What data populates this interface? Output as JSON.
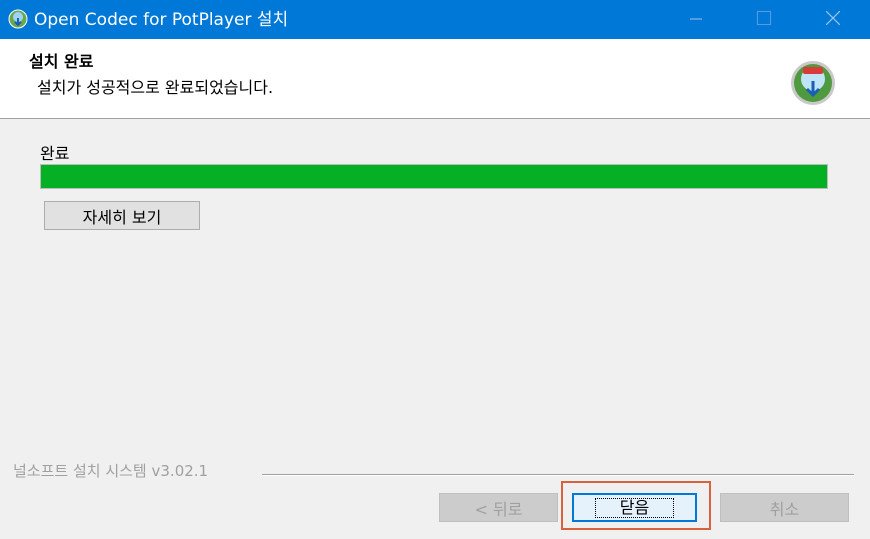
{
  "window": {
    "title": "Open Codec for PotPlayer 설치",
    "controls": {
      "minimize": "minimize-icon",
      "maximize": "maximize-icon",
      "close": "close-icon"
    }
  },
  "header": {
    "title": "설치 완료",
    "subtitle": "설치가 성공적으로 완료되었습니다."
  },
  "main": {
    "status_label": "완료",
    "progress_percent": 100,
    "details_button": "자세히 보기"
  },
  "footer": {
    "brand": "널소프트 설치 시스템 v3.02.1",
    "back_button": "< 뒤로",
    "close_button": "닫음",
    "cancel_button": "취소"
  },
  "colors": {
    "titlebar": "#0078d7",
    "progress_fill": "#06b025",
    "focus_highlight": "#d9623e"
  }
}
